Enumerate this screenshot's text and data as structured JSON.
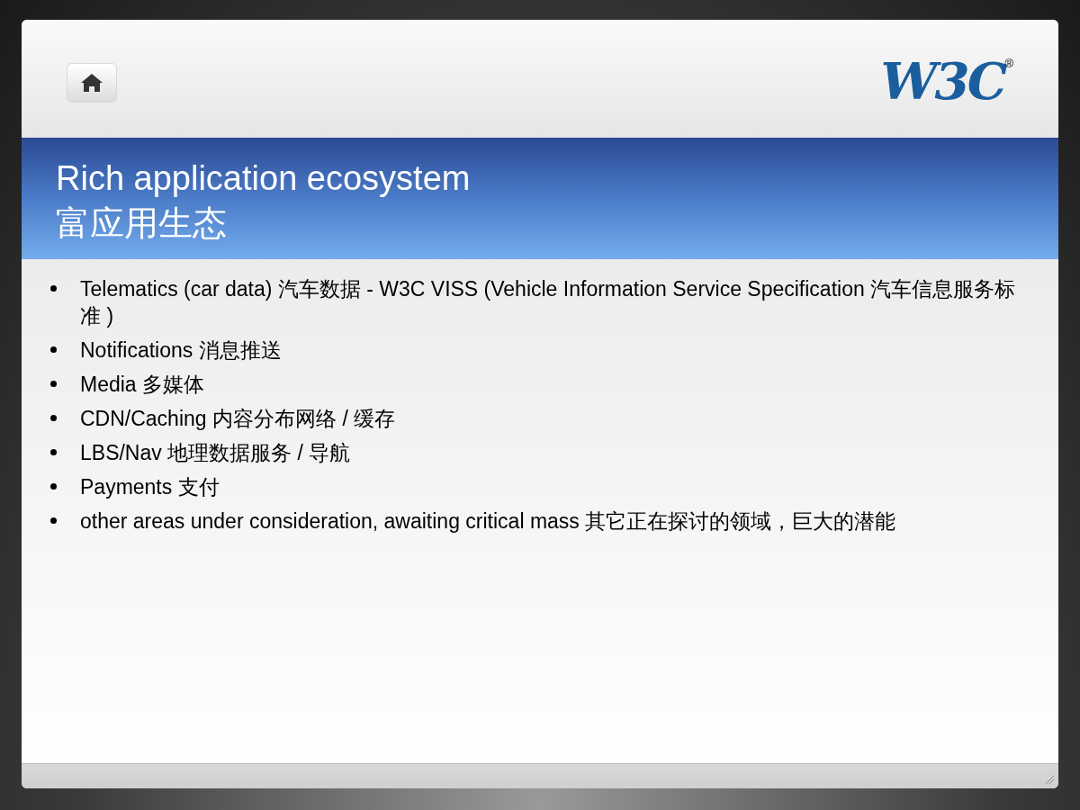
{
  "logo": {
    "text": "W3C",
    "mark": "®"
  },
  "title": {
    "lines": [
      "Rich application ecosystem",
      "富应用生态"
    ]
  },
  "bullets": [
    "Telematics (car data)  汽车数据  - W3C VISS (Vehicle Information Service Specification 汽车信息服务标准 )",
    "Notifications  消息推送",
    "Media  多媒体",
    "CDN/Caching  内容分布网络 / 缓存",
    "LBS/Nav  地理数据服务 / 导航",
    "Payments  支付",
    "other areas under consideration, awaiting critical mass  其它正在探讨的领域，巨大的潜能"
  ]
}
